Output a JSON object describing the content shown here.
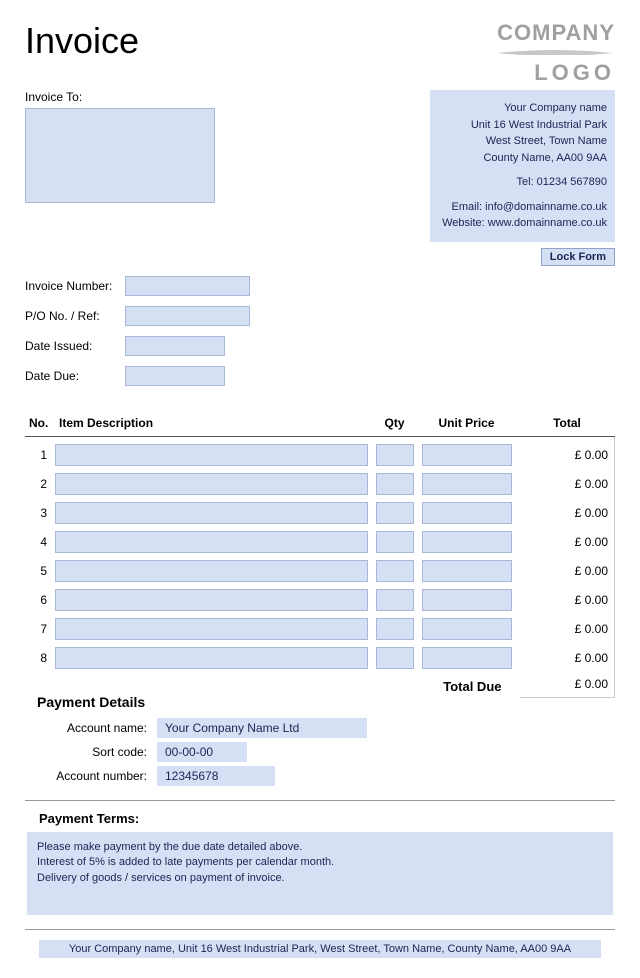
{
  "title": "Invoice",
  "logo": {
    "line1": "COMPANY",
    "line2": "LOGO"
  },
  "invoice_to_label": "Invoice To:",
  "company": {
    "name": "Your Company name",
    "addr1": "Unit 16 West Industrial Park",
    "addr2": "West Street, Town Name",
    "addr3": "County Name, AA00 9AA",
    "tel": "Tel: 01234 567890",
    "email": "Email: info@domainname.co.uk",
    "website": "Website: www.domainname.co.uk"
  },
  "lock_form_label": "Lock Form",
  "fields": {
    "invoice_number_label": "Invoice Number:",
    "po_ref_label": "P/O No. / Ref:",
    "date_issued_label": "Date Issued:",
    "date_due_label": "Date Due:"
  },
  "table": {
    "headers": {
      "no": "No.",
      "desc": "Item Description",
      "qty": "Qty",
      "price": "Unit Price",
      "total": "Total"
    },
    "rows": [
      "1",
      "2",
      "3",
      "4",
      "5",
      "6",
      "7",
      "8"
    ],
    "row_total": "£ 0.00",
    "total_due_label": "Total Due",
    "total_due_value": "£ 0.00"
  },
  "payment": {
    "heading": "Payment Details",
    "account_name_label": "Account name:",
    "account_name_value": "Your Company Name Ltd",
    "sort_code_label": "Sort code:",
    "sort_code_value": "00-00-00",
    "account_number_label": "Account number:",
    "account_number_value": "12345678"
  },
  "terms": {
    "heading": "Payment Terms:",
    "line1": "Please make payment by the due date detailed above.",
    "line2": "Interest of 5% is added to late payments per calendar month.",
    "line3": "Delivery of goods / services on payment of invoice."
  },
  "footer_address": "Your Company name, Unit 16 West Industrial Park, West Street, Town Name, County Name, AA00 9AA"
}
